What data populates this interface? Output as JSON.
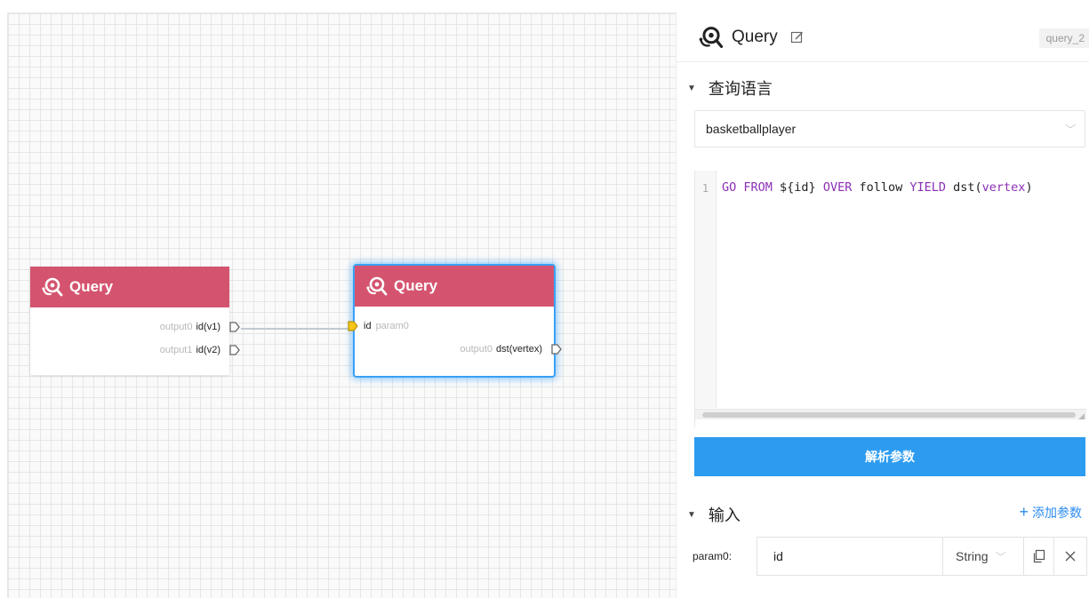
{
  "canvas": {
    "nodes": [
      {
        "title": "Query",
        "outputs": [
          {
            "name": "output0",
            "value": "id(v1)"
          },
          {
            "name": "output1",
            "value": "id(v2)"
          }
        ]
      },
      {
        "title": "Query",
        "inputs": [
          {
            "name": "id",
            "value": "param0"
          }
        ],
        "outputs": [
          {
            "name": "output0",
            "value": "dst(vertex)"
          }
        ]
      }
    ],
    "colors": {
      "node_header": "#d4546f",
      "selected_border": "#3aa0f5",
      "input_port": "#f5c518"
    }
  },
  "panel": {
    "title": "Query",
    "node_id": "query_2",
    "query_section": "查询语言",
    "space": "basketballplayer",
    "code": {
      "line_number": "1",
      "tokens": [
        {
          "t": "GO",
          "kw": true
        },
        {
          "t": " ",
          "kw": false
        },
        {
          "t": "FROM",
          "kw": true
        },
        {
          "t": " ${id} ",
          "kw": false
        },
        {
          "t": "OVER",
          "kw": true
        },
        {
          "t": " follow ",
          "kw": false
        },
        {
          "t": "YIELD",
          "kw": true
        },
        {
          "t": " dst(",
          "kw": false
        },
        {
          "t": "vertex",
          "kw": true
        },
        {
          "t": ")",
          "kw": false
        }
      ]
    },
    "parse_button": "解析参数",
    "input_section": "输入",
    "add_param": "添加参数",
    "params": [
      {
        "label": "param0:",
        "value": "id",
        "type": "String"
      }
    ],
    "accent": "#2d9cf0"
  }
}
